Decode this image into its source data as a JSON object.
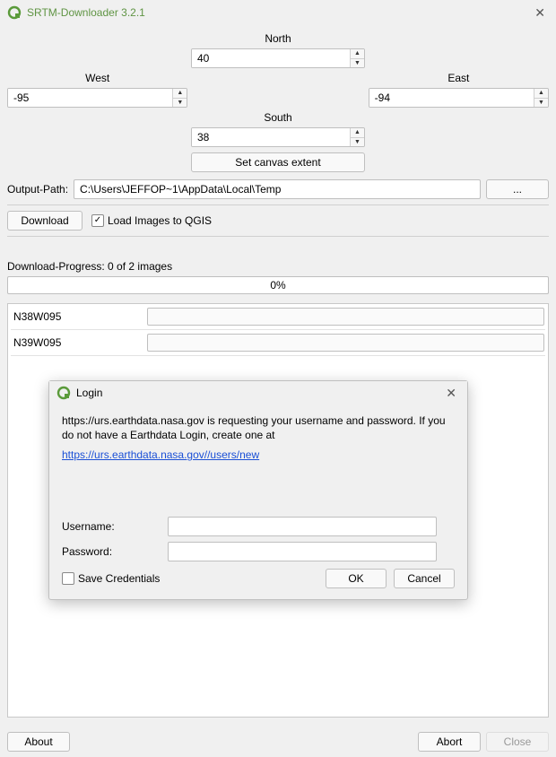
{
  "window": {
    "title": "SRTM-Downloader 3.2.1"
  },
  "extent": {
    "north_label": "North",
    "south_label": "South",
    "east_label": "East",
    "west_label": "West",
    "north_value": "40",
    "south_value": "38",
    "east_value": "-94",
    "west_value": "-95",
    "canvas_extent_label": "Set canvas extent"
  },
  "output": {
    "label": "Output-Path:",
    "value": "C:\\Users\\JEFFOP~1\\AppData\\Local\\Temp",
    "browse_label": "..."
  },
  "download": {
    "button_label": "Download",
    "checkbox_label": "Load Images to QGIS",
    "checkbox_checked": true
  },
  "progress": {
    "label": "Download-Progress: 0 of 2 images",
    "percent_text": "0%",
    "items": [
      {
        "name": "N38W095"
      },
      {
        "name": "N39W095"
      }
    ]
  },
  "footer": {
    "about": "About",
    "abort": "Abort",
    "close": "Close"
  },
  "login": {
    "title": "Login",
    "instruction_1": "https://urs.earthdata.nasa.gov is requesting your username and password. If you do not have a Earthdata Login, create one at",
    "link_text": "https://urs.earthdata.nasa.gov//users/new",
    "username_label": "Username:",
    "password_label": "Password:",
    "save_label": "Save Credentials",
    "ok": "OK",
    "cancel": "Cancel"
  }
}
